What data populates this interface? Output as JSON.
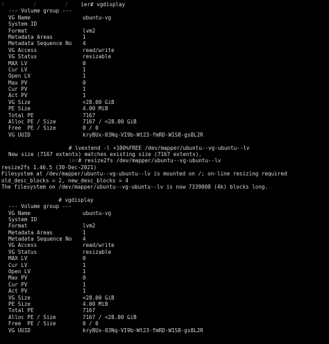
{
  "colors": {
    "background": "#000000",
    "foreground": "#d8d8d8",
    "redacted": "#555555"
  },
  "block1": {
    "prompt": {
      "redacted": "r         /         /    ",
      "tail": "ier# vgdisplay"
    },
    "header": "--- Volume group ---",
    "rows": [
      {
        "label": "VG Name",
        "value": "ubuntu-vg"
      },
      {
        "label": "System ID",
        "value": ""
      },
      {
        "label": "Format",
        "value": "lvm2"
      },
      {
        "label": "Metadata Areas",
        "value": "1"
      },
      {
        "label": "Metadata Sequence No",
        "value": "4"
      },
      {
        "label": "VG Access",
        "value": "read/write"
      },
      {
        "label": "VG Status",
        "value": "resizable"
      },
      {
        "label": "MAX LV",
        "value": "0"
      },
      {
        "label": "Cur LV",
        "value": "1"
      },
      {
        "label": "Open LV",
        "value": "1"
      },
      {
        "label": "Max PV",
        "value": "0"
      },
      {
        "label": "Cur PV",
        "value": "1"
      },
      {
        "label": "Act PV",
        "value": "1"
      },
      {
        "label": "VG Size",
        "value": "<28.00 GiB"
      },
      {
        "label": "PE Size",
        "value": "4.00 MiB"
      },
      {
        "label": "Total PE",
        "value": "7167"
      },
      {
        "label": "Alloc PE / Size",
        "value": "7167 / <28.00 GiB"
      },
      {
        "label": "Free  PE / Size",
        "value": "0 / 0"
      },
      {
        "label": "VG UUID",
        "value": "kryBUx-03Nq-VI9b-Wt23-fmRD-W1S8-gs8L2R"
      }
    ]
  },
  "middle": {
    "lvextend_prompt_redacted": "                   ",
    "lvextend_cmd": "# lvextend -l +100%FREE /dev/mapper/ubuntu--vg-ubuntu--lv",
    "lvextend_output": "New size (7167 extents) matches existing size (7167 extents).",
    "resize_prompt_redacted": "                   ier",
    "resize_cmd": "# resize2fs /dev/mapper/ubuntu--vg-ubuntu--lv",
    "output_lines": [
      "resize2fs 1.46.5 (30-Dec-2021)",
      "Filesystem at /dev/mapper/ubuntu--vg-ubuntu--lv is mounted on /; on-line resizing required",
      "old_desc_blocks = 2, new_desc_blocks = 4",
      "The filesystem on /dev/mapper/ubuntu--vg-ubuntu--lv is now 7339008 (4k) blocks long."
    ]
  },
  "block2": {
    "prompt": {
      "redacted": "                  ",
      "tail": "# vgdisplay"
    },
    "header": "--- Volume group ---",
    "rows": [
      {
        "label": "VG Name",
        "value": "ubuntu-vg"
      },
      {
        "label": "System ID",
        "value": ""
      },
      {
        "label": "Format",
        "value": "lvm2"
      },
      {
        "label": "Metadata Areas",
        "value": "1"
      },
      {
        "label": "Metadata Sequence No",
        "value": "4"
      },
      {
        "label": "VG Access",
        "value": "read/write"
      },
      {
        "label": "VG Status",
        "value": "resizable"
      },
      {
        "label": "MAX LV",
        "value": "0"
      },
      {
        "label": "Cur LV",
        "value": "1"
      },
      {
        "label": "Open LV",
        "value": "1"
      },
      {
        "label": "Max PV",
        "value": "0"
      },
      {
        "label": "Cur PV",
        "value": "1"
      },
      {
        "label": "Act PV",
        "value": "1"
      },
      {
        "label": "VG Size",
        "value": "<28.00 GiB"
      },
      {
        "label": "PE Size",
        "value": "4.00 MiB"
      },
      {
        "label": "Total PE",
        "value": "7167"
      },
      {
        "label": "Alloc PE / Size",
        "value": "7167 / <28.00 GiB"
      },
      {
        "label": "Free  PE / Size",
        "value": "0 / 0"
      },
      {
        "label": "VG UUID",
        "value": "kryBUx-03Nq-VI9b-Wt23-fmRD-W1S8-gs8L2R"
      }
    ]
  }
}
